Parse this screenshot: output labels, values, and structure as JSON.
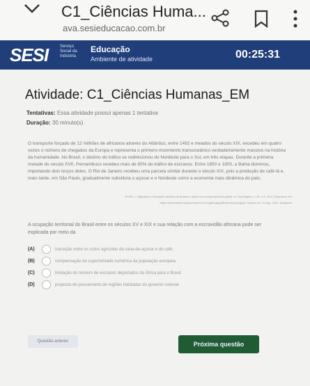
{
  "browser": {
    "title": "C1_Ciências Huma...",
    "url": "ava.sesieducacao.com.br"
  },
  "header": {
    "logo": "SESI",
    "logo_sub": "Serviço Social da Indústria",
    "section_title": "Educação",
    "section_sub": "Ambiente de atividade",
    "timer": "00:25:31"
  },
  "activity": {
    "title": "Atividade: C1_Ciências Humanas_EM",
    "attempts_label": "Tentativas:",
    "attempts_text": " Essa atividade possui apenas 1 tentativa",
    "duration_label": "Duração:",
    "duration_text": " 30 minuto(s)"
  },
  "question": {
    "text": "O transporte forçado de 12 milhões de africanos através do Atlântico, entre 1492 e meados do século XIX, excedeu em quatro vezes o número de chegados da Europa e representa o primeiro movimento transoceânico verdadeiramente massivo na história da humanidade. No Brasil, o destino do tráfico se redirecionou do Nordeste para o Sul, em três etapas. Durante a primeira metade do século XVII, Pernambuco recebeu mais de 80% do tráfico de escravos. Entre 1650 e 1800, a Bahia dominou, importando dois terços deles. O Rio de Janeiro recebeu uma parcela similar durante o século XIX, pois a produção de café lá e, mais tarde, em São Paulo, gradualmente substituía o açúcar e o Nordeste como a economia mais dinâmica do país.",
    "citation": "KLEIN, J. Migração e formação histórica da América Latina em uma perspectiva global. In: Sociologias, n. 20, s.d. 2014. Disponível em: https://www.scielo.br/j/soc/a/pnIVzVnCLgMmqIagaBmbvodqTqmgrqH. Acesso em: 10 ago. 2022. Adaptado.",
    "prompt": "A ocupação territorial do Brasil entre os séculos XV e XIX e sua relação com a escravidão africana pode ser explicada por meio da",
    "options": [
      {
        "letter": "(A)",
        "text": "transição entre os ciclos agrícolas da cana-de-açúcar e do café."
      },
      {
        "letter": "(B)",
        "text": "compensação da superioridade numérica da população europeia."
      },
      {
        "letter": "(C)",
        "text": "limitação do número de escravos deportados da África para o Brasil."
      },
      {
        "letter": "(D)",
        "text": "proposta de povoamento de regiões habitadas do governo colonial."
      }
    ]
  },
  "nav": {
    "prev_label": "Questão anterior",
    "next_label": "Próxima questão"
  }
}
